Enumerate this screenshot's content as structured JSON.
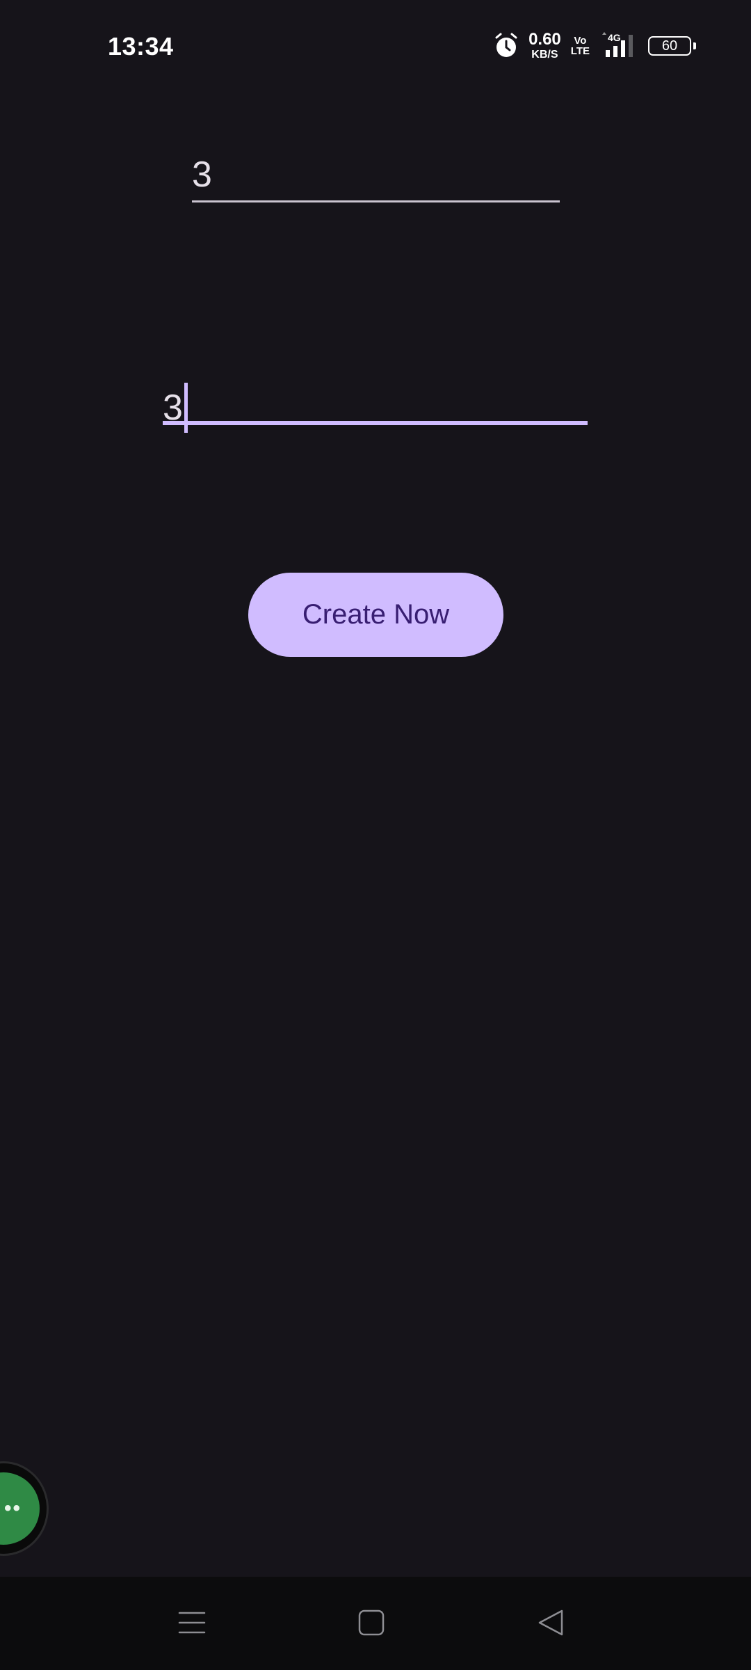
{
  "status_bar": {
    "time": "13:34",
    "net_speed_value": "0.60",
    "net_speed_unit": "KB/S",
    "volte_top": "Vo",
    "volte_bottom": "LTE",
    "network_type": "4G",
    "battery_level": "60",
    "icons": [
      "alarm-icon",
      "signal-icon",
      "battery-icon"
    ]
  },
  "form": {
    "field_one_value": "3",
    "field_two_value": "3"
  },
  "actions": {
    "create_label": "Create Now"
  },
  "floating_bubble": {
    "label": "••"
  },
  "nav": {
    "icons": [
      "menu-icon",
      "home-icon",
      "back-icon"
    ]
  },
  "colors": {
    "background": "#16141a",
    "primary": "#d0bcff",
    "on_primary": "#381e72",
    "bubble": "#2f8a45"
  }
}
